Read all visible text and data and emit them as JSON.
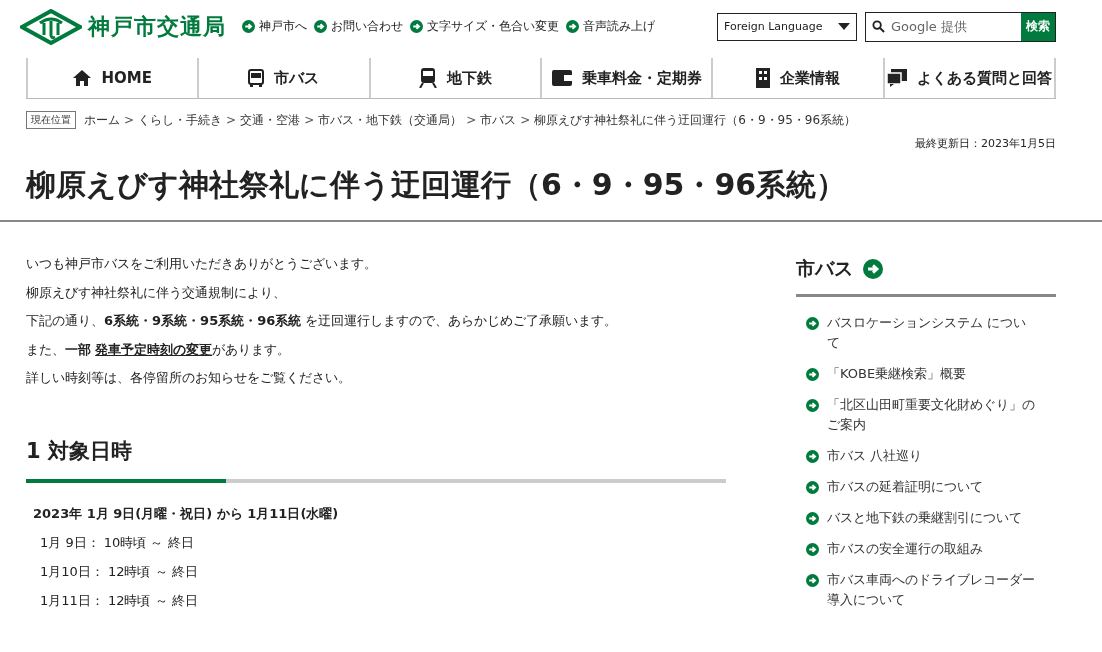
{
  "header": {
    "logo_text": "神戸市交通局",
    "utility_links": [
      "神戸市へ",
      "お問い合わせ",
      "文字サイズ・色合い変更",
      "音声読み上げ"
    ],
    "language_select": {
      "value": "Foreign Language"
    },
    "search": {
      "placeholder": "Google 提供",
      "button": "検索"
    }
  },
  "nav": [
    {
      "kind": "home",
      "label": "HOME"
    },
    {
      "kind": "bus",
      "label": "市バス"
    },
    {
      "kind": "train",
      "label": "地下鉄"
    },
    {
      "kind": "fare",
      "label": "乗車料金・定期券"
    },
    {
      "kind": "building",
      "label": "企業情報"
    },
    {
      "kind": "faq",
      "label": "よくある質問と回答"
    }
  ],
  "breadcrumb": {
    "label": "現在位置",
    "separator": ">",
    "items": [
      "ホーム",
      "くらし・手続き",
      "交通・空港",
      "市バス・地下鉄（交通局）",
      "市バス",
      "柳原えびす神社祭礼に伴う迂回運行（6・9・95・96系統）"
    ]
  },
  "updated": "最終更新日：2023年1月5日",
  "title": "柳原えびす神社祭礼に伴う迂回運行（6・9・95・96系統）",
  "intro": [
    {
      "text": "いつも神戸市バスをご利用いただきありがとうございます。"
    },
    {
      "text": "柳原えびす神社祭礼に伴う交通規制により、"
    },
    {
      "text": "下記の通り、**6系統・9系統・95系統・96系統** を迂回運行しますので、あらかじめご了承願います。"
    },
    {
      "text": "また、**一部** ",
      "link": "発車予定時刻の変更",
      "after": "があります。"
    },
    {
      "text": "詳しい時刻等は、各停留所のお知らせをご覧ください。"
    }
  ],
  "section": {
    "heading": "1  対象日時",
    "period": "2023年 1月 9日(月曜・祝日) から  1月11日(水曜)",
    "rows": [
      "1月  9日： 10時頃 ～ 終日",
      "1月10日： 12時頃 ～ 終日",
      "1月11日： 12時頃 ～ 終日"
    ]
  },
  "sidebar": {
    "title": "市バス",
    "links": [
      "バスロケーションシステム について",
      "「KOBE乗継検索」概要",
      "「北区山田町重要文化財めぐり」のご案内",
      "市バス 八社巡り",
      "市バスの延着証明について",
      "バスと地下鉄の乗継割引について",
      "市バスの安全運行の取組み",
      "市バス車両へのドライブレコーダー導入について"
    ]
  }
}
